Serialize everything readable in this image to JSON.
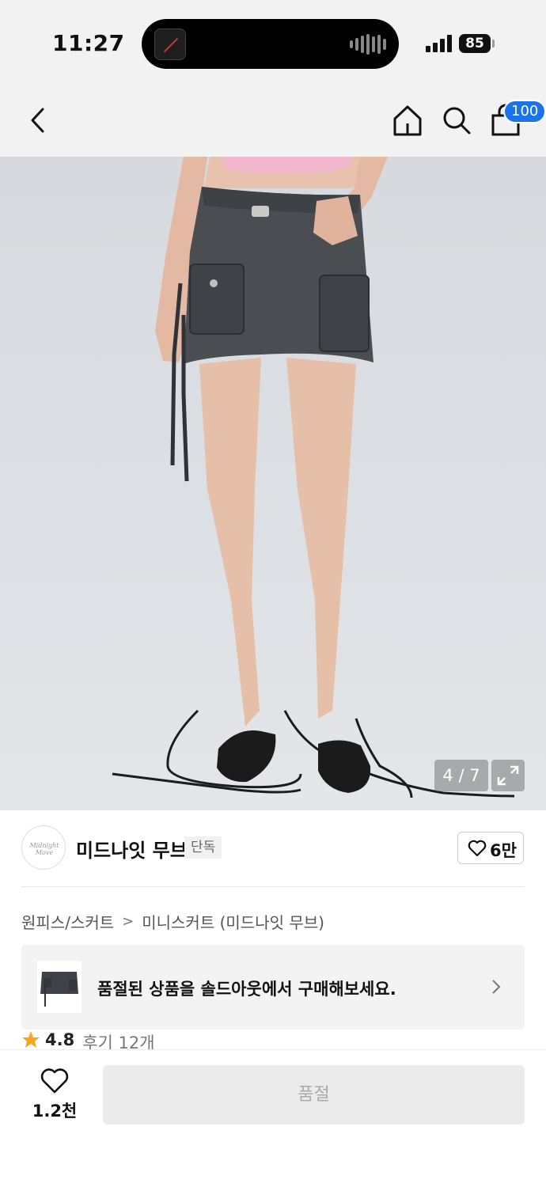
{
  "status_bar": {
    "time": "11:27",
    "battery": "85"
  },
  "nav": {
    "icons": [
      "chevron-left-icon",
      "home-icon",
      "search-icon",
      "shopping-bag-icon"
    ],
    "cart_badge": "100"
  },
  "gallery": {
    "counter": "4 / 7",
    "expand_icon": "expand-icon"
  },
  "brand": {
    "logo_text": "Midnight Move",
    "name": "미드나잇 무브",
    "exclusive_label": "단독",
    "like_count": "6만"
  },
  "breadcrumb": {
    "level1": "원피스/스커트",
    "separator": ">",
    "level2": "미니스커트 (미드나잇 무브)"
  },
  "soldout_banner": {
    "text": "품절된 상품을 솔드아웃에서 구매해보세요."
  },
  "rating": {
    "score": "4.8",
    "reviews": "후기 12개",
    "star_color": "#f5a623"
  },
  "bottom_bar": {
    "wishlist_count": "1.2천",
    "buy_button_label": "품절"
  },
  "colors": {
    "accent": "#1a73e8",
    "header_bg": "#f2f2f2"
  }
}
